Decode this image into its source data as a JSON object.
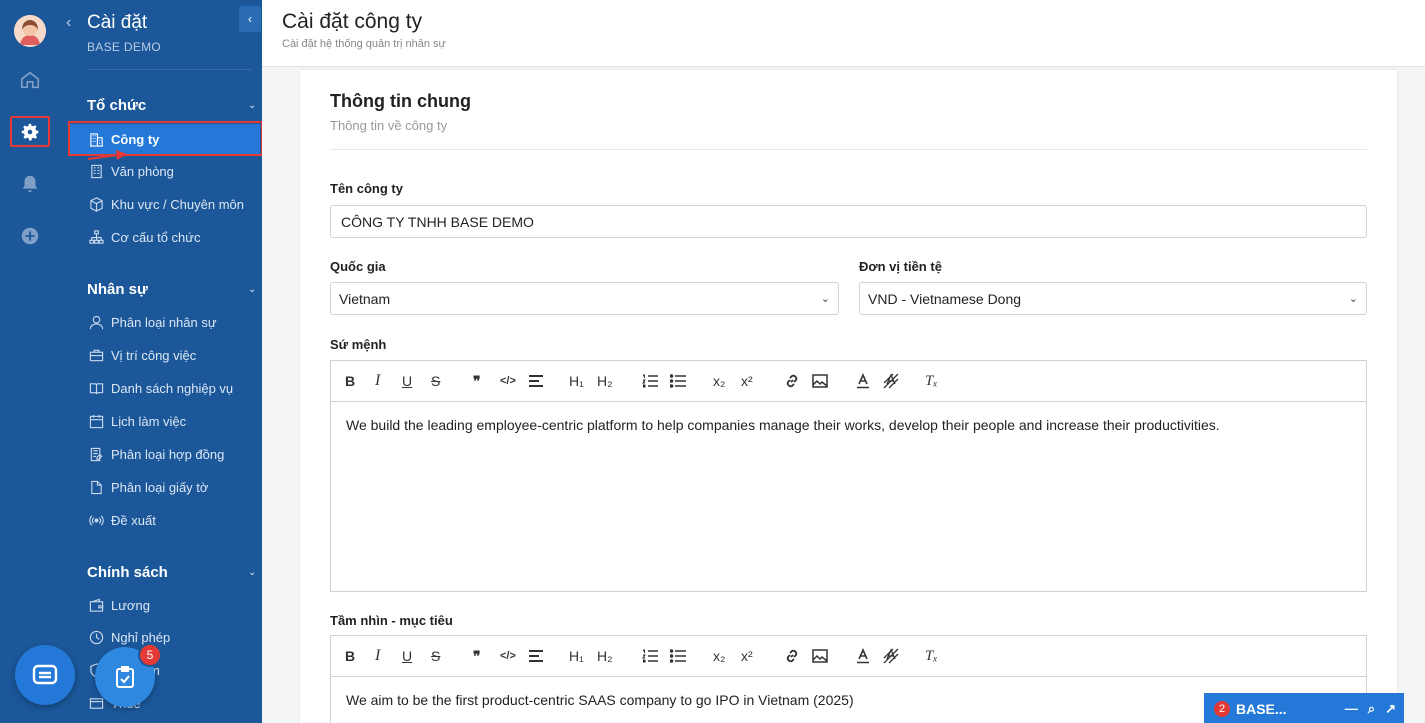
{
  "sidebar": {
    "title": "Cài đặt",
    "subtitle": "BASE DEMO",
    "back": "‹",
    "collapse": "‹",
    "sections": [
      {
        "title": "Tổ chức",
        "items": [
          {
            "label": "Công ty",
            "icon": "building-icon",
            "active": true
          },
          {
            "label": "Văn phòng",
            "icon": "office-icon"
          },
          {
            "label": "Khu vực / Chuyên môn",
            "icon": "cube-icon"
          },
          {
            "label": "Cơ cấu tổ chức",
            "icon": "org-chart-icon"
          }
        ]
      },
      {
        "title": "Nhân sự",
        "items": [
          {
            "label": "Phân loại nhân sự",
            "icon": "user-icon"
          },
          {
            "label": "Vị trí công việc",
            "icon": "briefcase-icon"
          },
          {
            "label": "Danh sách nghiệp vụ",
            "icon": "book-icon"
          },
          {
            "label": "Lịch làm việc",
            "icon": "calendar-icon"
          },
          {
            "label": "Phân loại hợp đồng",
            "icon": "contract-icon"
          },
          {
            "label": "Phân loại giấy tờ",
            "icon": "document-icon"
          },
          {
            "label": "Đề xuất",
            "icon": "broadcast-icon"
          }
        ]
      },
      {
        "title": "Chính sách",
        "items": [
          {
            "label": "Lương",
            "icon": "wallet-icon"
          },
          {
            "label": "Nghỉ phép",
            "icon": "clock-icon"
          },
          {
            "label": "m",
            "icon": "shield-icon"
          },
          {
            "label": "Thuế",
            "icon": "tax-icon"
          }
        ]
      }
    ],
    "task_badge": "5"
  },
  "header": {
    "title": "Cài đặt công ty",
    "subtitle": "Cài đặt hệ thống quản trị nhân sự"
  },
  "card": {
    "title": "Thông tin chung",
    "subtitle": "Thông tin về công ty",
    "company_label": "Tên công ty",
    "company_value": "CÔNG TY TNHH BASE DEMO",
    "country_label": "Quốc gia",
    "country_value": "Vietnam",
    "currency_label": "Đơn vị tiền tệ",
    "currency_value": "VND - Vietnamese Dong",
    "mission_label": "Sứ mệnh",
    "mission_text": "We build the leading employee-centric platform to help companies manage their works, develop their people and increase their productivities.",
    "vision_label": "Tầm nhìn - mục tiêu",
    "vision_text": "We aim to be the first product-centric SAAS company to go IPO in Vietnam (2025)"
  },
  "toolbar": {
    "bold": "B",
    "italic": "I",
    "underline": "U",
    "strike": "S",
    "quote": "❞",
    "code": "</>",
    "h1": "H₁",
    "h2": "H₂",
    "sub": "x₂",
    "sup": "x²",
    "clear": "Tₓ"
  },
  "chatbar": {
    "badge": "2",
    "label": "BASE..."
  },
  "colors": {
    "sidebar": "#1b5799",
    "accent": "#2479d8",
    "highlight": "#e53935"
  }
}
